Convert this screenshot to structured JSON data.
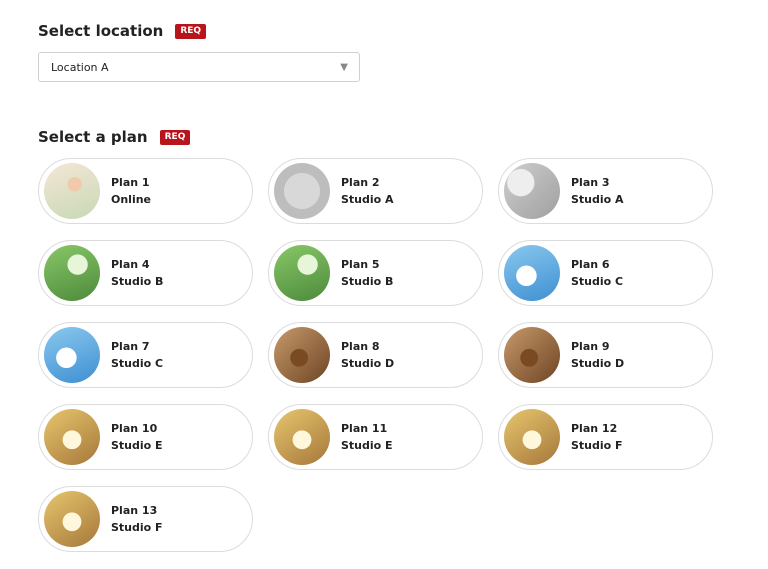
{
  "store_section": {
    "title": "Select location",
    "required_badge": "REQ",
    "selected_value": "Location A"
  },
  "reservation_section": {
    "title": "Select a plan",
    "required_badge": "REQ"
  },
  "plans": [
    {
      "line1": "Plan 1",
      "line2": "Online",
      "thumb_style": "t-person"
    },
    {
      "line1": "Plan 2",
      "line2": "Studio A",
      "thumb_style": "t-plain"
    },
    {
      "line1": "Plan 3",
      "line2": "Studio A",
      "thumb_style": "t-soft"
    },
    {
      "line1": "Plan 4",
      "line2": "Studio B",
      "thumb_style": "t-green"
    },
    {
      "line1": "Plan 5",
      "line2": "Studio B",
      "thumb_style": "t-green"
    },
    {
      "line1": "Plan 6",
      "line2": "Studio C",
      "thumb_style": "t-blue"
    },
    {
      "line1": "Plan 7",
      "line2": "Studio C",
      "thumb_style": "t-blue"
    },
    {
      "line1": "Plan 8",
      "line2": "Studio D",
      "thumb_style": "t-warm"
    },
    {
      "line1": "Plan 9",
      "line2": "Studio D",
      "thumb_style": "t-warm"
    },
    {
      "line1": "Plan 10",
      "line2": "Studio E",
      "thumb_style": "t-gold"
    },
    {
      "line1": "Plan 11",
      "line2": "Studio E",
      "thumb_style": "t-gold"
    },
    {
      "line1": "Plan 12",
      "line2": "Studio F",
      "thumb_style": "t-gold"
    },
    {
      "line1": "Plan 13",
      "line2": "Studio F",
      "thumb_style": "t-gold"
    }
  ]
}
